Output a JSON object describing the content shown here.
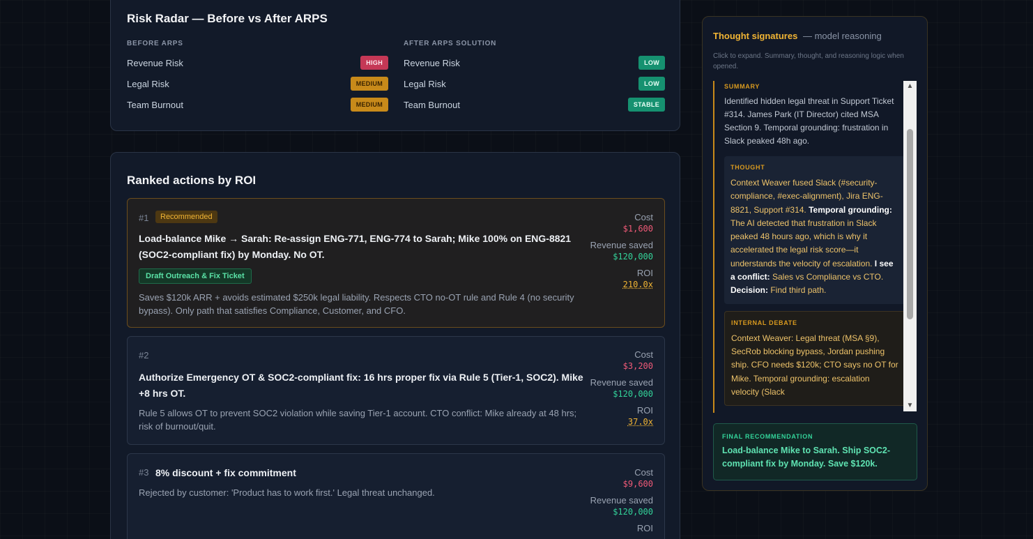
{
  "risk_radar": {
    "title": "Risk Radar — Before vs After ARPS",
    "before": {
      "heading": "BEFORE ARPS",
      "rows": [
        {
          "label": "Revenue Risk",
          "level": "HIGH"
        },
        {
          "label": "Legal Risk",
          "level": "MEDIUM"
        },
        {
          "label": "Team Burnout",
          "level": "MEDIUM"
        }
      ]
    },
    "after": {
      "heading": "AFTER ARPS SOLUTION",
      "rows": [
        {
          "label": "Revenue Risk",
          "level": "LOW"
        },
        {
          "label": "Legal Risk",
          "level": "LOW"
        },
        {
          "label": "Team Burnout",
          "level": "STABLE"
        }
      ]
    }
  },
  "ranked_actions": {
    "title": "Ranked actions by ROI",
    "cost_label": "Cost",
    "revenue_label": "Revenue saved",
    "roi_label": "ROI",
    "items": [
      {
        "rank": "#1",
        "tag": "Recommended",
        "headline": "Load-balance Mike → Sarah: Re-assign ENG-771, ENG-774 to Sarah; Mike 100% on ENG-8821 (SOC2-compliant fix) by Monday. No OT.",
        "action_button": "Draft Outreach & Fix Ticket",
        "description": "Saves $120k ARR + avoids estimated $250k legal liability. Respects CTO no-OT rule and Rule 4 (no security bypass). Only path that satisfies Compliance, Customer, and CFO.",
        "cost": "$1,600",
        "revenue_saved": "$120,000",
        "roi": "210.0x"
      },
      {
        "rank": "#2",
        "headline": "Authorize Emergency OT & SOC2-compliant fix: 16 hrs proper fix via Rule 5 (Tier-1, SOC2). Mike +8 hrs OT.",
        "description": "Rule 5 allows OT to prevent SOC2 violation while saving Tier-1 account. CTO conflict: Mike already at 48 hrs; risk of burnout/quit.",
        "cost": "$3,200",
        "revenue_saved": "$120,000",
        "roi": "37.0x"
      },
      {
        "rank": "#3",
        "headline": "8% discount + fix commitment",
        "description": "Rejected by customer: 'Product has to work first.' Legal threat unchanged.",
        "cost": "$9,600",
        "revenue_saved": "$120,000"
      }
    ]
  },
  "thought_signatures": {
    "title": "Thought signatures",
    "subtitle": "— model reasoning",
    "hint": "Click to expand. Summary, thought, and reasoning logic when opened.",
    "summary_label": "SUMMARY",
    "summary": "Identified hidden legal threat in Support Ticket #314. James Park (IT Director) cited MSA Section 9. Temporal grounding: frustration in Slack peaked 48h ago.",
    "thought_label": "THOUGHT",
    "thought": {
      "t1": "Context Weaver fused Slack (#security-compliance, #exec-alignment), Jira ENG-8821, Support #314. ",
      "b1": "Temporal grounding:",
      "t2": " The AI detected that frustration in Slack peaked 48 hours ago, which is why it accelerated the legal risk score—it understands the velocity of escalation. ",
      "b2": "I see a conflict:",
      "t3": " Sales vs Compliance vs CTO. ",
      "b3": "Decision:",
      "t4": " Find third path."
    },
    "debate_label": "INTERNAL DEBATE",
    "debate": "Context Weaver: Legal threat (MSA §9), SecRob blocking bypass, Jordan pushing ship. CFO needs $120k; CTO says no OT for Mike. Temporal grounding: escalation velocity (Slack",
    "final_label": "FINAL RECOMMENDATION",
    "final": "Load-balance Mike to Sarah. Ship SOC2-compliant fix by Monday. Save $120k."
  },
  "colors": {
    "accent_amber": "#f2b534",
    "risk_high": "#c53856",
    "risk_medium": "#c88a1a",
    "risk_low": "#169170",
    "cost_red": "#f05a78",
    "revenue_green": "#33d49a"
  },
  "icons": {
    "scroll_up": "scroll-up-arrow-icon",
    "scroll_down": "scroll-down-arrow-icon"
  }
}
